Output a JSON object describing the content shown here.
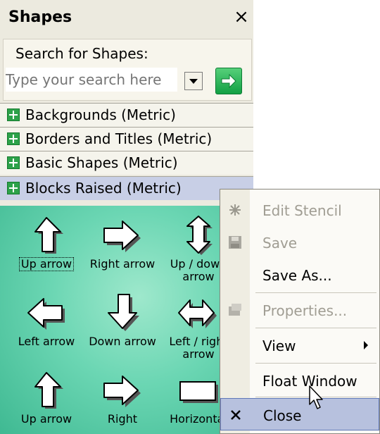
{
  "panel": {
    "title": "Shapes",
    "close_glyph": "×",
    "search_label": "Search for Shapes:",
    "search_placeholder": "Type your search here"
  },
  "stencils": [
    {
      "label": "Backgrounds (Metric)"
    },
    {
      "label": "Borders and Titles (Metric)"
    },
    {
      "label": "Basic Shapes (Metric)"
    },
    {
      "label": "Blocks Raised (Metric)",
      "active": true
    }
  ],
  "shapes": [
    {
      "label": "Up arrow",
      "icon": "up-arrow-icon"
    },
    {
      "label": "Right arrow",
      "icon": "right-arrow-icon"
    },
    {
      "label": "Up / down arrow",
      "icon": "up-down-arrow-icon"
    },
    {
      "label": "Left arrow",
      "icon": "left-arrow-icon"
    },
    {
      "label": "Down arrow",
      "icon": "down-arrow-icon"
    },
    {
      "label": "Left / right arrow",
      "icon": "left-right-arrow-icon"
    },
    {
      "label": "Up arrow",
      "icon": "up-arrow-icon"
    },
    {
      "label": "Right",
      "icon": "right-arrow-icon"
    },
    {
      "label": "Horizontal",
      "icon": "horizontal-block-icon"
    }
  ],
  "context_menu": {
    "items": [
      {
        "label": "Edit Stencil",
        "enabled": false,
        "icon": "edit-stencil-icon"
      },
      {
        "label": "Save",
        "enabled": false,
        "icon": "save-icon"
      },
      {
        "label": "Save As...",
        "enabled": true
      },
      {
        "label": "Properties...",
        "enabled": false,
        "icon": "properties-icon"
      },
      {
        "label": "View",
        "enabled": true,
        "submenu": true
      },
      {
        "label": "Float Window",
        "enabled": true
      },
      {
        "label": "Close",
        "enabled": true,
        "highlighted": true,
        "icon": "close-icon"
      }
    ]
  },
  "colors": {
    "panel_bg": "#eceadf",
    "stencil_active_bg": "#c8cfe6",
    "shape_area": "#6bd6b3",
    "menu_highlight": "#b7c1de",
    "go_button": "#12a044"
  }
}
